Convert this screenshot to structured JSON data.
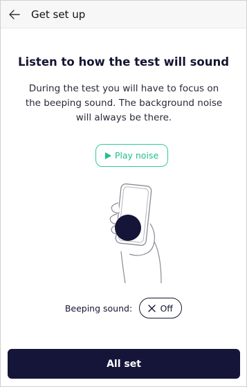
{
  "header": {
    "title": "Get set up",
    "back_icon": "arrow-left-icon"
  },
  "main": {
    "title": "Listen to how the test will sound",
    "description": "During the test you will have to focus on the beeping sound. The background noise will always be there.",
    "play_button": {
      "label": "Play noise",
      "icon": "play-icon",
      "color": "#1fbf8a"
    },
    "illustration": {
      "icon": "hand-holding-phone-icon",
      "dot_color": "#15153a"
    },
    "beeping": {
      "label": "Beeping sound:",
      "toggle_label": "Off",
      "toggle_icon": "close-icon"
    }
  },
  "footer": {
    "cta_label": "All set",
    "cta_color": "#15153a"
  }
}
